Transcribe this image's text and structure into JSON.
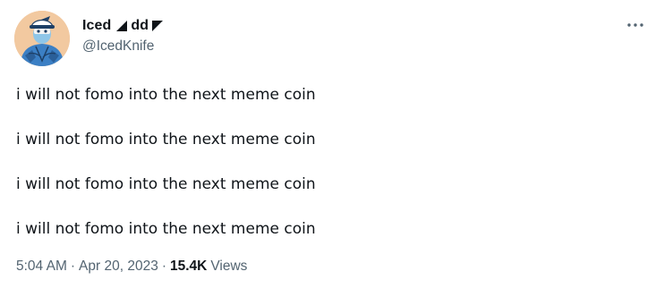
{
  "author": {
    "display_name": "Iced",
    "display_name_suffix": "dd",
    "handle": "@IcedKnife",
    "avatar_icon": "cartoon-character-avatar"
  },
  "menu": {
    "more_icon": "more-dots-icon"
  },
  "tweet": {
    "lines": [
      "i will not fomo into the next meme coin",
      "i will not fomo into the next meme coin",
      "i will not fomo into the next meme coin",
      "i will not fomo into the next meme coin"
    ]
  },
  "meta": {
    "time": "5:04 AM",
    "separator": "·",
    "date": "Apr 20, 2023",
    "views_count": "15.4K",
    "views_label": "Views"
  },
  "colors": {
    "text_primary": "#0f1419",
    "text_secondary": "#536471",
    "background": "#ffffff"
  }
}
